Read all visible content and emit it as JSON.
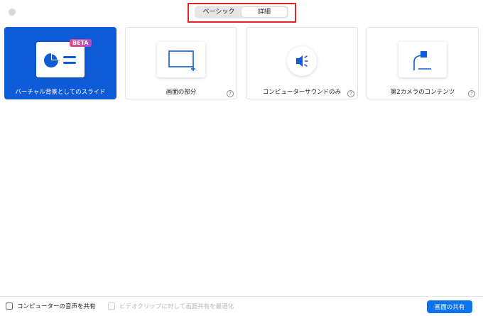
{
  "tabs": [
    {
      "label": "ベーシック",
      "active": false
    },
    {
      "label": "詳細",
      "active": true
    }
  ],
  "cards": [
    {
      "label": "バーチャル背景としてのスライド",
      "badge": "BETA",
      "selected": true,
      "icon": "slides-icon"
    },
    {
      "label": "画面の部分",
      "help": "?",
      "icon": "screen-portion-icon"
    },
    {
      "label": "コンピューターサウンドのみ",
      "help": "?",
      "icon": "speaker-icon"
    },
    {
      "label": "第2カメラのコンテンツ",
      "help": "?",
      "icon": "document-camera-icon"
    }
  ],
  "footer": {
    "share_audio": "コンピューターの音声を共有",
    "optimize_video": "ビデオクリップに対して画面共有を最適化",
    "share_button": "画面の共有"
  },
  "colors": {
    "accent": "#0e5bd8",
    "button": "#0e72ed",
    "highlight": "#e0242b"
  }
}
